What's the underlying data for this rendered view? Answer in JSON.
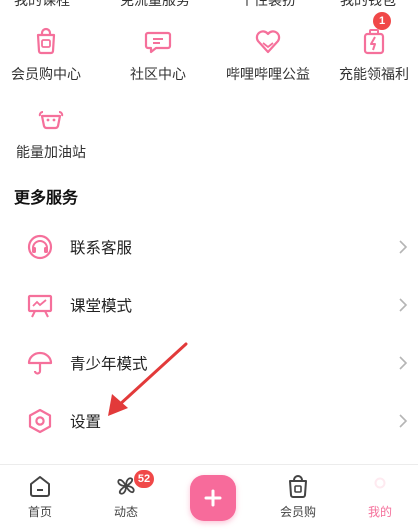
{
  "top_row_partial": [
    "我的课程",
    "免流量服务",
    "个性装扮",
    "我的钱包"
  ],
  "services": [
    {
      "label": "会员购中心",
      "icon": "bag-icon"
    },
    {
      "label": "社区中心",
      "icon": "chat-icon"
    },
    {
      "label": "哔哩哔哩公益",
      "icon": "heart-icon"
    },
    {
      "label": "充能领福利",
      "icon": "battery-gift-icon",
      "badge": "1"
    },
    {
      "label": "能量加油站",
      "icon": "energy-cup-icon"
    }
  ],
  "more_services": {
    "title": "更多服务",
    "items": [
      {
        "label": "联系客服",
        "icon": "headset-icon"
      },
      {
        "label": "课堂模式",
        "icon": "classroom-icon"
      },
      {
        "label": "青少年模式",
        "icon": "umbrella-icon"
      },
      {
        "label": "设置",
        "icon": "settings-icon"
      }
    ]
  },
  "tabbar": {
    "home": "首页",
    "dynamic": "动态",
    "dynamic_badge": "52",
    "mall": "会员购",
    "mine": "我的"
  },
  "colors": {
    "accent": "#f5709b",
    "badge": "#f04848",
    "annotation_arrow": "#e23a3a"
  }
}
